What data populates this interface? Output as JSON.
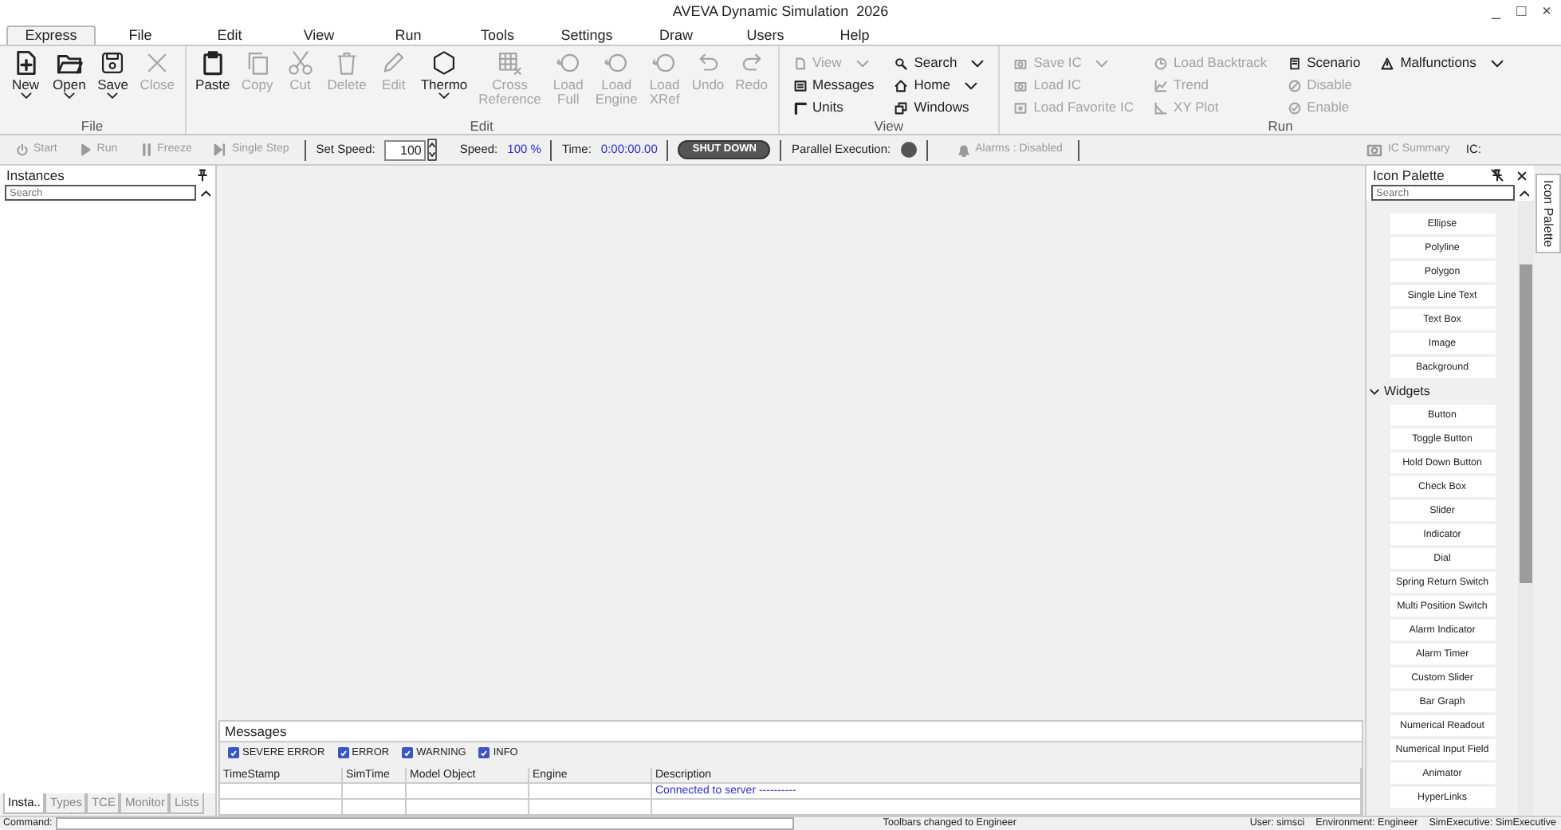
{
  "window": {
    "title": "AVEVA Dynamic Simulation  2026",
    "controls": [
      "_",
      "□",
      "×"
    ]
  },
  "menu_tabs": [
    {
      "label": "Express",
      "selected": true
    },
    {
      "label": "File",
      "selected": false
    },
    {
      "label": "Edit",
      "selected": false
    },
    {
      "label": "View",
      "selected": false
    },
    {
      "label": "Run",
      "selected": false
    },
    {
      "label": "Tools",
      "selected": false
    },
    {
      "label": "Settings",
      "selected": false
    },
    {
      "label": "Draw",
      "selected": false
    },
    {
      "label": "Users",
      "selected": false
    },
    {
      "label": "Help",
      "selected": false
    }
  ],
  "ribbon": [
    {
      "label": "File",
      "kind": "large",
      "buttons": [
        {
          "label": "New",
          "disabled": false,
          "dropdown": true
        },
        {
          "label": "Open",
          "disabled": false,
          "dropdown": true
        },
        {
          "label": "Save",
          "disabled": false,
          "dropdown": true
        },
        {
          "label": "Close",
          "disabled": true,
          "dropdown": false
        }
      ]
    },
    {
      "label": "Edit",
      "kind": "large",
      "buttons": [
        {
          "label": "Paste",
          "disabled": false,
          "dropdown": false
        },
        {
          "label": "Copy",
          "disabled": true,
          "dropdown": false
        },
        {
          "label": "Cut",
          "disabled": true,
          "dropdown": false
        },
        {
          "label": "Delete",
          "disabled": true,
          "dropdown": false
        },
        {
          "label": "Edit",
          "disabled": true,
          "dropdown": false
        },
        {
          "label": "Thermo",
          "disabled": false,
          "dropdown": true
        },
        {
          "label": "Cross Reference",
          "disabled": true,
          "dropdown": false
        },
        {
          "label": "Load Full",
          "disabled": true,
          "dropdown": false
        },
        {
          "label": "Load Engine",
          "disabled": true,
          "dropdown": false
        },
        {
          "label": "Load XRef",
          "disabled": true,
          "dropdown": false
        },
        {
          "label": "Undo",
          "disabled": true,
          "dropdown": false
        },
        {
          "label": "Redo",
          "disabled": true,
          "dropdown": false
        }
      ]
    },
    {
      "label": "View",
      "kind": "small",
      "columns": [
        [
          {
            "label": "View",
            "disabled": true,
            "dropdown": true
          },
          {
            "label": "Messages",
            "disabled": false,
            "dropdown": false
          },
          {
            "label": "Units",
            "disabled": false,
            "dropdown": false
          }
        ],
        [
          {
            "label": "Search",
            "disabled": false,
            "dropdown": true
          },
          {
            "label": "Home",
            "disabled": false,
            "dropdown": true
          },
          {
            "label": "Windows",
            "disabled": false,
            "dropdown": false
          }
        ]
      ]
    },
    {
      "label": "Run",
      "kind": "small",
      "columns": [
        [
          {
            "label": "Save IC",
            "disabled": true,
            "dropdown": true
          },
          {
            "label": "Load IC",
            "disabled": true,
            "dropdown": false
          },
          {
            "label": "Load Favorite IC",
            "disabled": true,
            "dropdown": false
          }
        ],
        [
          {
            "label": "Load Backtrack",
            "disabled": true,
            "dropdown": false
          },
          {
            "label": "Trend",
            "disabled": true,
            "dropdown": false
          },
          {
            "label": "XY Plot",
            "disabled": true,
            "dropdown": false
          }
        ],
        [
          {
            "label": "Scenario",
            "disabled": false,
            "dropdown": false
          },
          {
            "label": "Disable",
            "disabled": true,
            "dropdown": false
          },
          {
            "label": "Enable",
            "disabled": true,
            "dropdown": false
          }
        ],
        [
          {
            "label": "Malfunctions",
            "disabled": false,
            "dropdown": true
          }
        ]
      ]
    }
  ],
  "toolbar": {
    "buttons": [
      {
        "label": "Start",
        "disabled": true
      },
      {
        "label": "Run",
        "disabled": true
      },
      {
        "label": "Freeze",
        "disabled": true
      },
      {
        "label": "Single Step",
        "disabled": true
      }
    ],
    "speed_label": "Set Speed:",
    "speed_value": "100",
    "speed_reading_label": "Speed:",
    "speed_reading": "100 %",
    "time_label": "Time:",
    "time": "0:00:00.00",
    "shutdown": "SHUT DOWN",
    "parallel_label": "Parallel Execution:",
    "alarms": {
      "label": "Alarms : Disabled",
      "disabled": true
    },
    "ic_summary": {
      "label": "IC Summary",
      "disabled": true
    },
    "ic_label": "IC:"
  },
  "instances": {
    "title": "Instances",
    "search_placeholder": "Search",
    "tabs": [
      {
        "label": "Insta..",
        "selected": true
      },
      {
        "label": "Types",
        "selected": false
      },
      {
        "label": "TCE",
        "selected": false
      },
      {
        "label": "Monitor",
        "selected": false
      },
      {
        "label": "Lists",
        "selected": false
      }
    ]
  },
  "messages": {
    "title": "Messages",
    "filters": [
      {
        "label": "SEVERE ERROR",
        "checked": true
      },
      {
        "label": "ERROR",
        "checked": true
      },
      {
        "label": "WARNING",
        "checked": true
      },
      {
        "label": "INFO",
        "checked": true
      }
    ],
    "columns": [
      "TimeStamp",
      "SimTime",
      "Model Object",
      "Engine",
      "Description"
    ],
    "rows": [
      {
        "description": "Connected to server ----------"
      }
    ]
  },
  "palette": {
    "title": "Icon Palette",
    "search_placeholder": "Search",
    "items": [
      "Ellipse",
      "Polyline",
      "Polygon",
      "Single Line Text",
      "Text Box",
      "Image",
      "Background"
    ],
    "sections": [
      {
        "label": "Widgets",
        "expanded": true,
        "items": [
          "Button",
          "Toggle Button",
          "Hold Down Button",
          "Check Box",
          "Slider",
          "Indicator",
          "Dial",
          "Spring Return Switch",
          "Multi Position Switch",
          "Alarm Indicator",
          "Alarm Timer",
          "Custom Slider",
          "Bar Graph",
          "Numerical Readout",
          "Numerical Input Field",
          "Animator",
          "HyperLinks"
        ]
      }
    ]
  },
  "side_tab": "Icon Palette",
  "status_bar": {
    "command_label": "Command:",
    "message": "Toolbars changed to Engineer",
    "user": "User: simsci",
    "environment": "Environment: Engineer",
    "executive": "SimExecutive: SimExecutive"
  }
}
